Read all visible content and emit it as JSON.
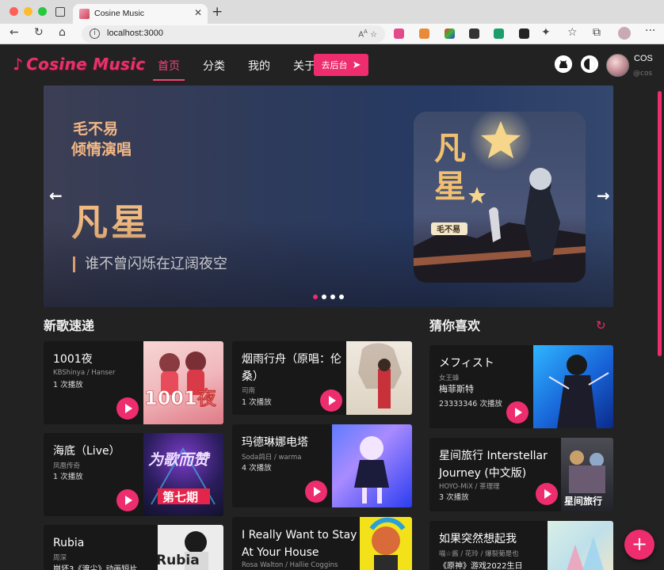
{
  "browser": {
    "tab_title": "Cosine Music",
    "url": "localhost:3000",
    "read_aloud": "Aᴬ"
  },
  "app": {
    "logo": "Cosine Music",
    "nav": [
      "首页",
      "分类",
      "我的",
      "关于"
    ],
    "admin_button": "去后台",
    "user_name": "COS",
    "user_handle": "@cos"
  },
  "banner": {
    "line1": "毛不易",
    "line2": "倾情演唱",
    "title": "凡星",
    "subtitle": "谁不曾闪烁在辽阔夜空",
    "art_title": "凡\n星",
    "art_artist": "毛不易",
    "slides": 4,
    "active_slide": 0
  },
  "sections": {
    "new_songs": "新歌速递",
    "guess": "猜你喜欢"
  },
  "new_songs_left": [
    {
      "title": "1001夜",
      "artist": "KBShinya / Hanser",
      "plays": "1 次播放",
      "cover_text": "1001夜"
    },
    {
      "title": "海底（Live）",
      "artist": "凤凰传奇",
      "plays": "1 次播放",
      "cover_text": "第七期",
      "cover_text2": "为歌而赞"
    },
    {
      "title": "Rubia",
      "artist": "周深",
      "plays": "崩坏3《渡尘》动画短片",
      "cover_text": "Rubia"
    }
  ],
  "new_songs_right": [
    {
      "title": "烟雨行舟（原唱：伦桑）",
      "artist": "司南",
      "plays": "1 次播放"
    },
    {
      "title": "玛德琳娜电塔",
      "artist": "Soda鸽日 / warma",
      "plays": "4 次播放"
    },
    {
      "title": "I Really Want to Stay At Your House",
      "artist": "Rosa Walton / Hallie Coggins",
      "plays": ""
    }
  ],
  "guess_songs": [
    {
      "title": "メフィスト",
      "artist": "女王蜂",
      "subtitle": "梅菲斯特",
      "plays": "23333346 次播放"
    },
    {
      "title": "星间旅行 Interstellar Journey (中文版)",
      "artist": "HOYO-MiX / 茶理理",
      "plays": "3 次播放",
      "cover_text": "星间旅行"
    },
    {
      "title": "如果突然想起我",
      "artist": "喵☆酱 / 花玲 / 爆裂菊是也",
      "plays": "《原神》游戏2022生日"
    }
  ],
  "colors": {
    "accent": "#ee2d6e",
    "bg": "#222222",
    "card": "#181818"
  }
}
